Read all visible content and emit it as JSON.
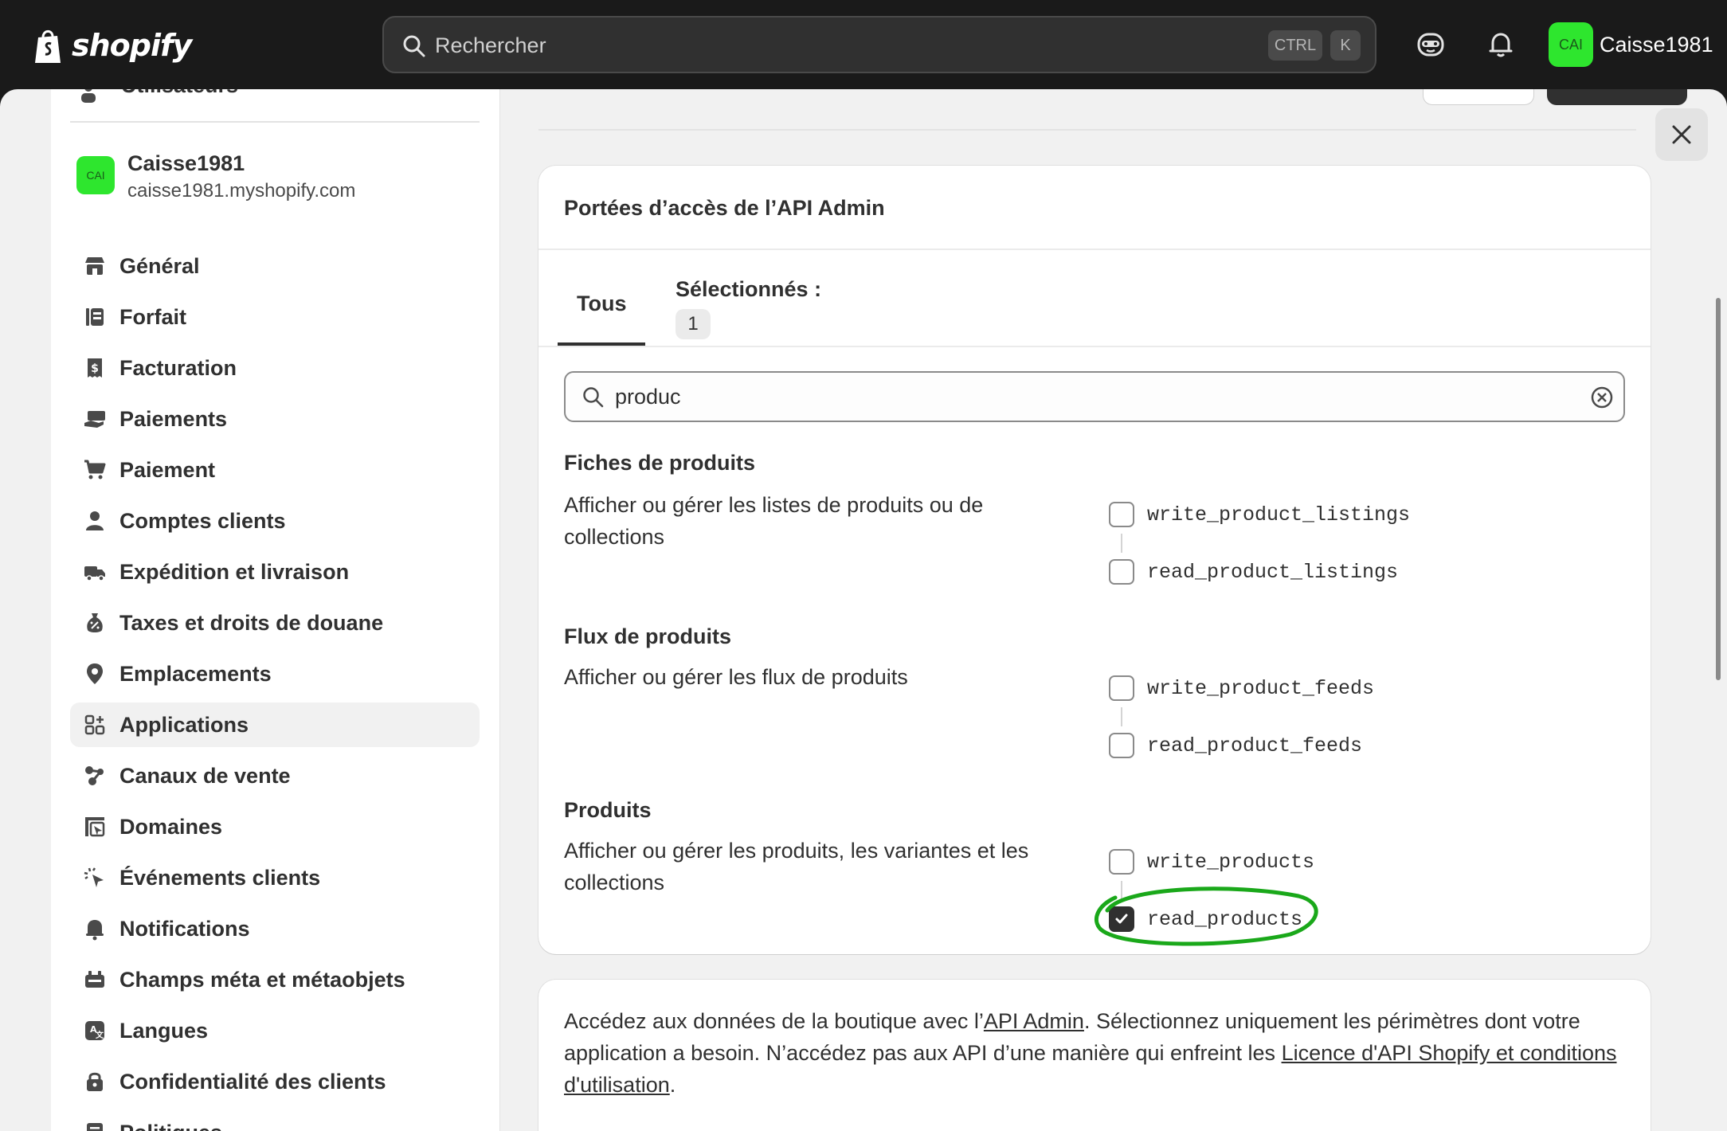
{
  "topbar": {
    "brand": "shopify",
    "search_placeholder": "Rechercher",
    "kbd_ctrl": "CTRL",
    "kbd_k": "K",
    "avatar_initials": "CAI",
    "user_name": "Caisse1981"
  },
  "sidebar": {
    "cut_item": "Utilisateurs",
    "store_avatar": "CAI",
    "store_name": "Caisse1981",
    "store_url": "caisse1981.myshopify.com",
    "items": [
      {
        "label": "Général",
        "icon": "store-icon"
      },
      {
        "label": "Forfait",
        "icon": "plan-icon"
      },
      {
        "label": "Facturation",
        "icon": "billing-icon"
      },
      {
        "label": "Paiements",
        "icon": "payments-icon"
      },
      {
        "label": "Paiement",
        "icon": "cart-icon"
      },
      {
        "label": "Comptes clients",
        "icon": "person-icon"
      },
      {
        "label": "Expédition et livraison",
        "icon": "truck-icon"
      },
      {
        "label": "Taxes et droits de douane",
        "icon": "tax-icon"
      },
      {
        "label": "Emplacements",
        "icon": "location-icon"
      },
      {
        "label": "Applications",
        "icon": "apps-icon",
        "active": true
      },
      {
        "label": "Canaux de vente",
        "icon": "channels-icon"
      },
      {
        "label": "Domaines",
        "icon": "domains-icon"
      },
      {
        "label": "Événements clients",
        "icon": "cursor-icon"
      },
      {
        "label": "Notifications",
        "icon": "bell-icon"
      },
      {
        "label": "Champs méta et métaobjets",
        "icon": "metafields-icon"
      },
      {
        "label": "Langues",
        "icon": "language-icon"
      },
      {
        "label": "Confidentialité des clients",
        "icon": "lock-icon"
      },
      {
        "label": "Politiques",
        "icon": "policy-icon"
      }
    ]
  },
  "scopes_card": {
    "title": "Portées d’accès de l’API Admin",
    "tab_all": "Tous",
    "tab_selected": "Sélectionnés :",
    "selected_count": "1",
    "filter_value": "produc",
    "sections": [
      {
        "title": "Fiches de produits",
        "desc": "Afficher ou gérer les listes de produits ou de collections",
        "write": {
          "name": "write_product_listings",
          "checked": false
        },
        "read": {
          "name": "read_product_listings",
          "checked": false
        }
      },
      {
        "title": "Flux de produits",
        "desc": "Afficher ou gérer les flux de produits",
        "write": {
          "name": "write_product_feeds",
          "checked": false
        },
        "read": {
          "name": "read_product_feeds",
          "checked": false
        }
      },
      {
        "title": "Produits",
        "desc": "Afficher ou gérer les produits, les variantes et les collections",
        "write": {
          "name": "write_products",
          "checked": false
        },
        "read": {
          "name": "read_products",
          "checked": true
        }
      }
    ]
  },
  "info_card": {
    "text_1": "Accédez aux données de la boutique avec l’",
    "link_api": "API Admin",
    "text_2": ". Sélectionnez uniquement les périmètres dont votre application a besoin. N’accédez pas aux API d’une manière qui enfreint les ",
    "link_license": "Licence d'API Shopify et conditions d'utilisation",
    "text_3": "."
  },
  "colors": {
    "accent_green": "#2ee62e",
    "annotation_green": "#1aa81a",
    "topbar": "#1a1a1a"
  }
}
